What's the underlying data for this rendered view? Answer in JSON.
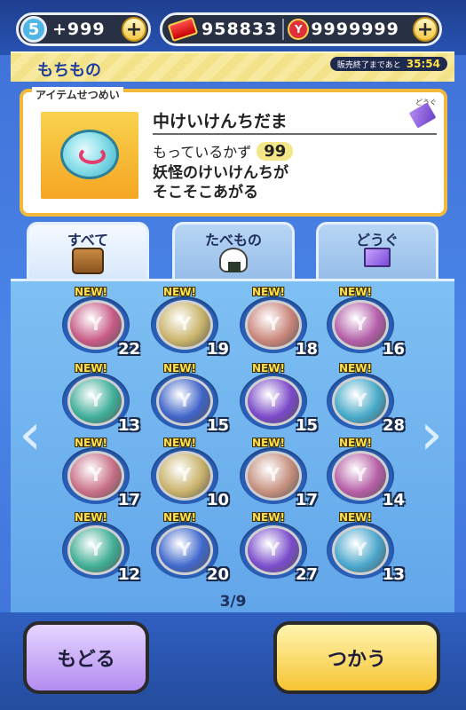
{
  "header": {
    "level": "5",
    "stamina": "+999",
    "tickets": "958833",
    "coins": "9999999",
    "plus": "+"
  },
  "section": {
    "title": "もちもの",
    "timer_label": "販売終了まであと",
    "timer": "35:54"
  },
  "item_info": {
    "caption": "アイテムせつめい",
    "name": "中けいけんちだま",
    "count_label": "もっているかず",
    "count": "99",
    "desc_line1": "妖怪のけいけんちが",
    "desc_line2": "そこそこあがる",
    "category_tag": "どうぐ"
  },
  "tabs": [
    {
      "label": "すべて",
      "icon": "bag-icon"
    },
    {
      "label": "たべもの",
      "icon": "rice-ball-icon"
    },
    {
      "label": "どうぐ",
      "icon": "ticket-icon"
    }
  ],
  "grid": {
    "new_label": "NEW!",
    "items": [
      {
        "qty": "22",
        "color": "#c85a86"
      },
      {
        "qty": "19",
        "color": "#c9b36a"
      },
      {
        "qty": "18",
        "color": "#c9857a"
      },
      {
        "qty": "16",
        "color": "#b35da8"
      },
      {
        "qty": "13",
        "color": "#3fae99"
      },
      {
        "qty": "15",
        "color": "#3e63c8"
      },
      {
        "qty": "15",
        "color": "#7a48c8"
      },
      {
        "qty": "28",
        "color": "#46a9c8"
      },
      {
        "qty": "17",
        "color": "#c86f86"
      },
      {
        "qty": "10",
        "color": "#c9b26a"
      },
      {
        "qty": "17",
        "color": "#c58f7d"
      },
      {
        "qty": "14",
        "color": "#b65ea6"
      },
      {
        "qty": "12",
        "color": "#3fae94"
      },
      {
        "qty": "20",
        "color": "#3f67cc"
      },
      {
        "qty": "27",
        "color": "#7a4ccc"
      },
      {
        "qty": "13",
        "color": "#49a6cc"
      }
    ]
  },
  "pager": "3/9",
  "buttons": {
    "back": "もどる",
    "use": "つかう"
  },
  "colors": {
    "background": "#4a86e8",
    "accent": "#f2b93a"
  }
}
